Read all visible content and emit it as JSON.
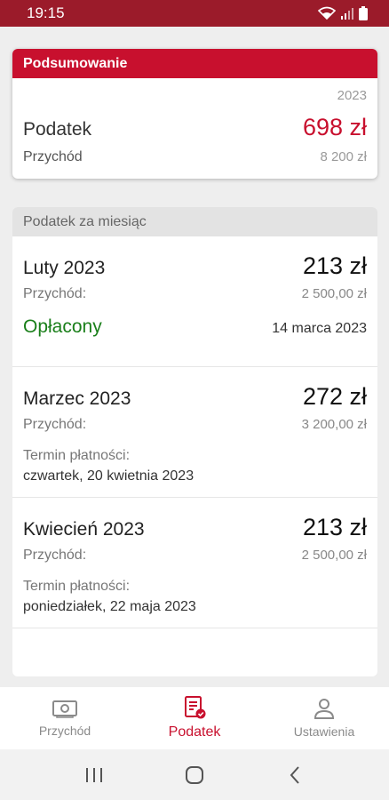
{
  "status_bar": {
    "time": "19:15"
  },
  "summary": {
    "header": "Podsumowanie",
    "year": "2023",
    "tax_label": "Podatek",
    "tax_value": "698 zł",
    "income_label": "Przychód",
    "income_value": "8 200 zł"
  },
  "monthly": {
    "header": "Podatek za miesiąc",
    "items": [
      {
        "title": "Luty 2023",
        "amount": "213 zł",
        "income_label": "Przychód:",
        "income_value": "2 500,00 zł",
        "status": "Opłacony",
        "status_date": "14 marca 2023"
      },
      {
        "title": "Marzec 2023",
        "amount": "272 zł",
        "income_label": "Przychód:",
        "income_value": "3 200,00 zł",
        "due_label": "Termin płatności:",
        "due_value": "czwartek, 20 kwietnia 2023"
      },
      {
        "title": "Kwiecień 2023",
        "amount": "213 zł",
        "income_label": "Przychód:",
        "income_value": "2 500,00 zł",
        "due_label": "Termin płatności:",
        "due_value": "poniedziałek, 22 maja 2023"
      }
    ]
  },
  "bottom_nav": {
    "items": [
      {
        "label": "Przychód",
        "icon": "cash-icon",
        "active": false
      },
      {
        "label": "Podatek",
        "icon": "tax-document-icon",
        "active": true
      },
      {
        "label": "Ustawienia",
        "icon": "person-icon",
        "active": false
      }
    ]
  },
  "colors": {
    "status_bar": "#9b1b2a",
    "accent": "#c8102e",
    "paid": "#1a7f1a"
  }
}
